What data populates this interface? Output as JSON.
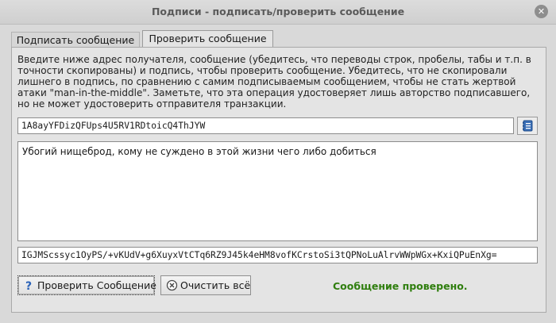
{
  "window": {
    "title": "Подписи - подписать/проверить сообщение",
    "close_glyph": "✕"
  },
  "tabs": [
    {
      "label": "Подписать сообщение",
      "active": false
    },
    {
      "label": "Проверить сообщение",
      "active": true
    }
  ],
  "description": "Введите ниже адрес получателя, сообщение (убедитесь, что переводы строк, пробелы, табы и т.п. в точности скопированы) и подпись, чтобы проверить сообщение. Убедитесь, что не скопировали лишнего в подпись, по сравнению с самим подписываемым сообщением, чтобы не стать жертвой атаки \"man-in-the-middle\". Заметьте, что эта операция удостоверяет лишь авторство подписавшего, но не может удостоверить отправителя транзакции.",
  "address_value": "1A8ayYFDizQFUps4U5RV1RDtoicQ4ThJYW",
  "message_value": "Убогий нищеброд, кому не суждено в этой жизни чего либо добиться",
  "signature_value": "IGJMScssyc1OyPS/+vKUdV+g6XuyxVtCTq6RZ9J45k4eHM8vofKCrstoSi3tQPNoLuAlrvWWpWGx+KxiQPuEnXg=",
  "buttons": {
    "verify": "Проверить Сообщение",
    "clear": "Очистить всё"
  },
  "status": "Сообщение проверено.",
  "colors": {
    "status_text": "#2f7e0e",
    "window_bg": "#d9d9d9"
  },
  "icons": [
    "close-icon",
    "address-book-icon",
    "question-icon",
    "clear-icon"
  ]
}
